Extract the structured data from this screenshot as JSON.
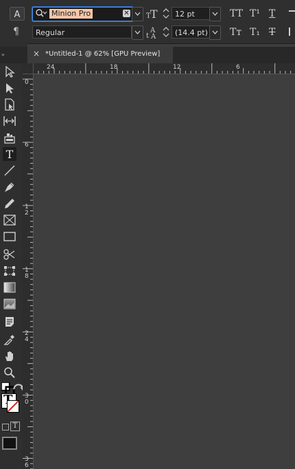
{
  "control_panel": {
    "character_mode_icon": "character-formatting-icon",
    "paragraph_mode_icon": "paragraph-formatting-icon",
    "font_family": {
      "value": "Minion Pro",
      "search_icon": "search-icon",
      "clear_icon": "clear-icon"
    },
    "font_style": {
      "value": "Regular"
    },
    "font_size": {
      "value": "12 pt",
      "icon": "font-size-icon"
    },
    "leading": {
      "value": "(14.4 pt)",
      "icon": "leading-icon"
    },
    "case_buttons": {
      "all_caps": "TT",
      "superscript": "T¹",
      "underline": "T",
      "small_caps": "Tт",
      "subscript": "T₁",
      "strikethrough": "T"
    }
  },
  "document_tab": {
    "close_label": "×",
    "title": "*Untitled-1 @ 62% [GPU Preview]"
  },
  "rulers": {
    "horizontal": [
      "24",
      "18",
      "12",
      "6"
    ],
    "vertical": [
      "0",
      "6",
      "1\n2",
      "1\n8",
      "2\n4",
      "3\n0",
      "3\n6"
    ]
  },
  "tools": [
    "selection-tool-icon",
    "direct-selection-tool-icon",
    "page-tool-icon",
    "gap-tool-icon",
    "content-collector-icon",
    "type-tool-icon",
    "line-tool-icon",
    "pen-tool-icon",
    "pencil-tool-icon",
    "rectangle-frame-tool-icon",
    "rectangle-tool-icon",
    "scissors-tool-icon",
    "free-transform-tool-icon",
    "gradient-swatch-tool-icon",
    "gradient-feather-tool-icon",
    "note-tool-icon",
    "eyedropper-tool-icon",
    "hand-tool-icon",
    "zoom-tool-icon"
  ],
  "fill_stroke": {
    "swap_icon": "swap-arrows-icon",
    "default_icon": "default-colors-icon",
    "fill_label": "T",
    "apply_container_label": "T"
  },
  "colors": {
    "panel_bg": "#2f2f2f",
    "canvas_bg": "#3e3e3e",
    "focus_blue": "#4a90e2",
    "selection_highlight": "#f3c6a7"
  }
}
